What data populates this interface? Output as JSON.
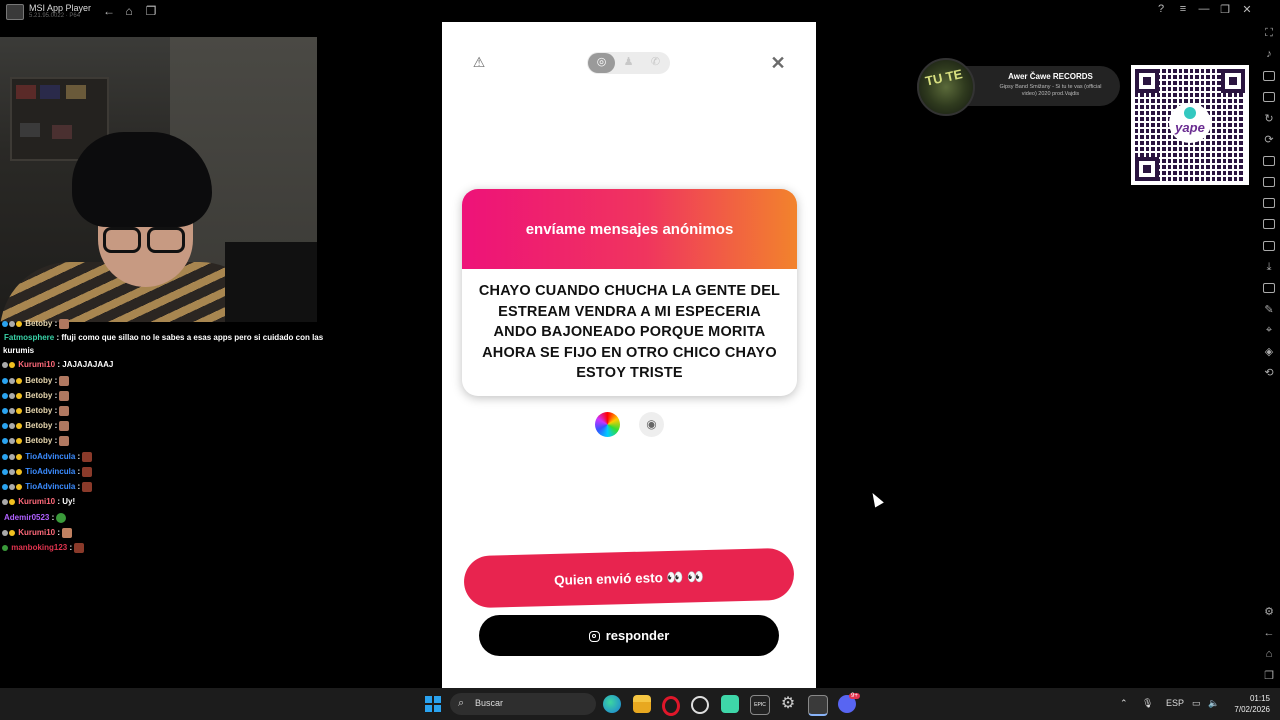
{
  "window": {
    "title": "MSI App Player",
    "version": "5.21.95.0022 · P64"
  },
  "chat": [
    {
      "user": "Betoby",
      "text": "",
      "color": "#e8d8b0",
      "top": 0
    },
    {
      "user": "Fatmosphere",
      "text": " : ffuji como que sillao no le sabes a esas apps pero si cuidado con las",
      "color": "#39d3a8"
    },
    {
      "user": "",
      "text": "kurumis",
      "color": "#fff"
    },
    {
      "user": "Kurumi10",
      "text": " : JAJAJAJAAJ",
      "color": "#ff6a7a"
    },
    {
      "user": "Betoby",
      "text": " :",
      "color": "#e8d8b0"
    },
    {
      "user": "Betoby",
      "text": " :",
      "color": "#e8d8b0"
    },
    {
      "user": "Betoby",
      "text": " :",
      "color": "#e8d8b0"
    },
    {
      "user": "Betoby",
      "text": " :",
      "color": "#e8d8b0"
    },
    {
      "user": "Betoby",
      "text": " :",
      "color": "#e8d8b0"
    },
    {
      "user": "TioAdvincula",
      "text": " :",
      "color": "#3b8cff"
    },
    {
      "user": "TioAdvincula",
      "text": " :",
      "color": "#3b8cff"
    },
    {
      "user": "TioAdvincula",
      "text": " :",
      "color": "#3b8cff"
    },
    {
      "user": "Kurumi10",
      "text": " : Uy!",
      "color": "#ff6a7a"
    },
    {
      "user": "Ademir0523",
      "text": " :",
      "color": "#b060ff"
    },
    {
      "user": "Kurumi10",
      "text": " :",
      "color": "#ff6a7a"
    },
    {
      "user": "manboking123",
      "text": " :",
      "color": "#e0334e"
    }
  ],
  "ngl": {
    "card_title": "envíame mensajes anónimos",
    "message": "CHAYO CUANDO CHUCHA LA GENTE DEL ESTREAM VENDRA A MI ESPECERIA ANDO BAJONEADO PORQUE MORITA AHORA SE FIJO EN OTRO CHICO CHAYO ESTOY TRISTE",
    "who_sent": "Quien envió esto 👀 👀",
    "reply": "responder",
    "close": "✕",
    "warn": "⚠"
  },
  "music": {
    "cover_text": "TU TE",
    "artist": "Awer Čawe RECORDS",
    "song": "Gipsy Band Smižany - Si tu te vas (official video) 2020 prod.Vajdis"
  },
  "qr": {
    "brand": "yape"
  },
  "taskbar": {
    "search_placeholder": "Buscar",
    "lang": "ESP",
    "time": "01:15",
    "date": "7/02/2026",
    "discord_badge": "9+"
  },
  "colors": {
    "gradient_start": "#ee1279",
    "gradient_end": "#f2832c",
    "who_button": "#e8244f",
    "reply_button": "#000000"
  }
}
